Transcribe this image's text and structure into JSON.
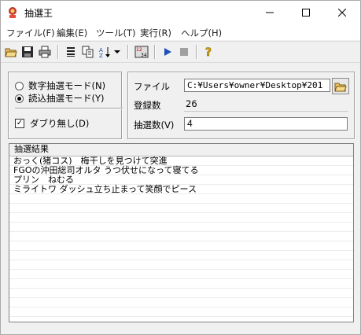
{
  "window": {
    "title": "抽選王"
  },
  "menu": [
    {
      "label": "ファイル(F)"
    },
    {
      "label": "編集(E)"
    },
    {
      "label": "ツール(T)"
    },
    {
      "label": "実行(R)"
    },
    {
      "label": "ヘルプ(H)"
    }
  ],
  "toolbar": {
    "icons": [
      "open-folder-icon",
      "save-icon",
      "print-icon",
      "list-icon",
      "copy-icon",
      "sort-icon",
      "chevron-down-icon",
      "number-icon",
      "play-icon",
      "stop-icon",
      "help-icon"
    ]
  },
  "mode": {
    "number_mode_label": "数字抽選モード(N)",
    "read_mode_label": "読込抽選モード(Y)",
    "selected": "read",
    "no_duplicate_label": "ダブり無し(D)",
    "no_duplicate_checked": true
  },
  "file_panel": {
    "file_label": "ファイル",
    "file_path": "C:¥Users¥owner¥Desktop¥201",
    "registered_label": "登録数",
    "registered_value": "26",
    "draw_count_label": "抽選数(V)",
    "draw_count_value": "4"
  },
  "results": {
    "header": "抽選結果",
    "rows": [
      "おっく(猪コス)　梅干しを見つけて突進",
      "FGOの沖田総司オルタ うつ伏せになって寝てる",
      "プリン　ねむる",
      "ミライトワ ダッシュ立ち止まって笑顔でピース"
    ]
  },
  "colors": {
    "titlebar": "#ffffff",
    "background": "#f0f0f0",
    "play": "#1f4fb8",
    "stop": "#a0a0a0"
  }
}
